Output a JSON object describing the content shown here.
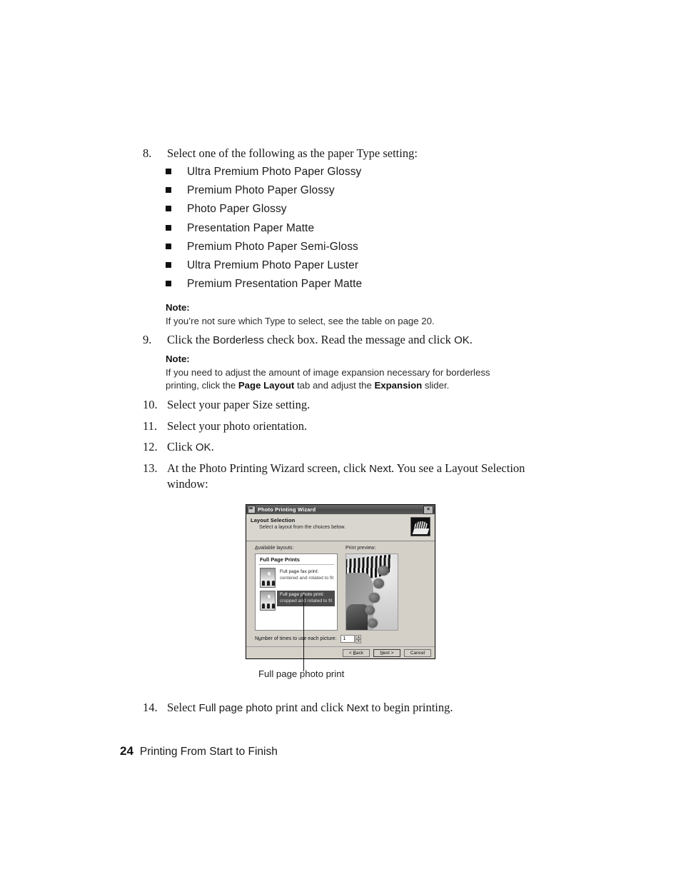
{
  "steps": {
    "s8": {
      "num": "8.",
      "text": "Select one of the following as the paper Type setting:"
    },
    "s9": {
      "num": "9.",
      "pre": "Click the ",
      "ui1": "Borderless",
      "mid": " check box. Read the message and click ",
      "ui2": "OK",
      "post": "."
    },
    "s10": {
      "num": "10.",
      "text": "Select your paper Size setting."
    },
    "s11": {
      "num": "11.",
      "text": "Select your photo orientation."
    },
    "s12": {
      "num": "12.",
      "pre": "Click ",
      "ui1": "OK",
      "post": "."
    },
    "s13": {
      "num": "13.",
      "pre": "At the Photo Printing Wizard screen, click ",
      "ui1": "Next",
      "post": ". You see a Layout Selection window:"
    },
    "s14": {
      "num": "14.",
      "pre": "Select ",
      "ui1": "Full page photo",
      "mid": " print and click ",
      "ui2": "Next",
      "post": " to begin printing."
    }
  },
  "paper_types": [
    "Ultra Premium Photo Paper Glossy",
    "Premium Photo Paper Glossy",
    "Photo Paper Glossy",
    "Presentation Paper Matte",
    "Premium Photo Paper Semi-Gloss",
    "Ultra Premium Photo Paper Luster",
    "Premium Presentation Paper Matte"
  ],
  "note1": {
    "title": "Note:",
    "body": "If you’re not sure which Type to select, see the table on page 20."
  },
  "note2": {
    "title": "Note:",
    "line1": "If you need to adjust the amount of image expansion necessary for borderless",
    "line2_pre": "printing, click the ",
    "line2_ui1": "Page Layout",
    "line2_mid": " tab and adjust the ",
    "line2_ui2": "Expansion",
    "line2_post": " slider."
  },
  "dialog": {
    "titlebar": {
      "title": "Photo Printing Wizard",
      "close_label": "×"
    },
    "header": {
      "title": "Layout Selection",
      "subtitle": "Select a layout from the choices below."
    },
    "labels": {
      "available": "A̲vailable layouts:",
      "preview": "Print preview:"
    },
    "group_title": "Full Page Prints",
    "layouts": [
      {
        "line1": "Full page fax print:",
        "line2": "centered and rotated to fit",
        "selected": false
      },
      {
        "line1": "Full page photo print:",
        "line2": "cropped and rotated to fit",
        "selected": true
      }
    ],
    "times": {
      "label": "Nu̲mber of times to use each picture:",
      "value": "1",
      "up": "▲",
      "down": "▼"
    },
    "buttons": {
      "back": "< B̲ack",
      "next": "N̲ext >",
      "cancel": "Cancel"
    }
  },
  "callout": {
    "label": "Full page photo print"
  },
  "footer": {
    "page": "24",
    "title": "Printing From Start to Finish"
  }
}
